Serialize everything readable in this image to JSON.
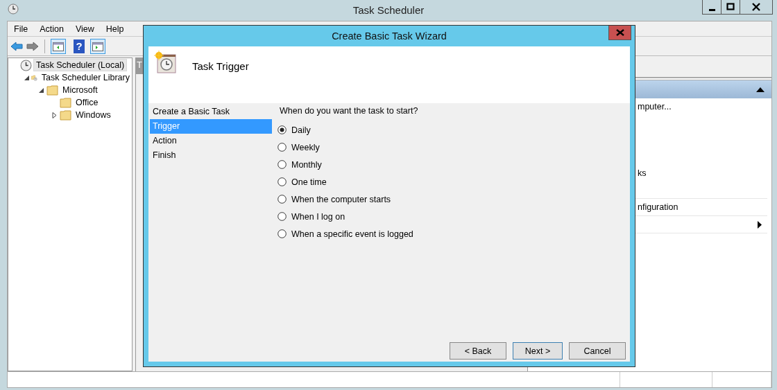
{
  "window": {
    "title": "Task Scheduler"
  },
  "menu": [
    "File",
    "Action",
    "View",
    "Help"
  ],
  "toolbar": [
    {
      "kind": "back"
    },
    {
      "kind": "forward"
    },
    {
      "kind": "sep"
    },
    {
      "kind": "show-pane"
    },
    {
      "kind": "help",
      "glyph": "?"
    },
    {
      "kind": "action-pane"
    }
  ],
  "tree": [
    {
      "label": "Task Scheduler (Local)",
      "selected": true,
      "children": [
        {
          "label": "Task Scheduler Library",
          "selected": false,
          "expanded": true,
          "children": [
            {
              "label": "Microsoft",
              "selected": false,
              "expanded": true,
              "children": [
                {
                  "label": "Office",
                  "selected": false
                },
                {
                  "label": "Windows",
                  "selected": false,
                  "expanded": false
                }
              ]
            }
          ]
        }
      ]
    }
  ],
  "middle": {
    "column_1": "T"
  },
  "actions": [
    {
      "kind": "text",
      "text": "mputer..."
    },
    {
      "kind": "hidden"
    },
    {
      "kind": "hidden"
    },
    {
      "kind": "hidden"
    },
    {
      "kind": "text",
      "text": "ks"
    },
    {
      "kind": "hidden"
    },
    {
      "kind": "text",
      "text": "nfiguration",
      "divider": true
    },
    {
      "kind": "submenu",
      "divider": true
    },
    {
      "kind": "hidden",
      "divider": true
    }
  ],
  "dialog": {
    "title": "Create Basic Task Wizard",
    "header": "Task Trigger",
    "steps": [
      {
        "label": "Create a Basic Task",
        "selected": false
      },
      {
        "label": "Trigger",
        "selected": true
      },
      {
        "label": "Action",
        "selected": false
      },
      {
        "label": "Finish",
        "selected": false
      }
    ],
    "question": "When do you want the task to start?",
    "options": [
      {
        "label": "Daily",
        "selected": true
      },
      {
        "label": "Weekly",
        "selected": false
      },
      {
        "label": "Monthly",
        "selected": false
      },
      {
        "label": "One time",
        "selected": false
      },
      {
        "label": "When the computer starts",
        "selected": false
      },
      {
        "label": "When I log on",
        "selected": false
      },
      {
        "label": "When a specific event is logged",
        "selected": false
      }
    ],
    "buttons": [
      {
        "label": "< Back",
        "default": false
      },
      {
        "label": "Next >",
        "default": true
      },
      {
        "label": "Cancel",
        "default": false
      }
    ]
  }
}
